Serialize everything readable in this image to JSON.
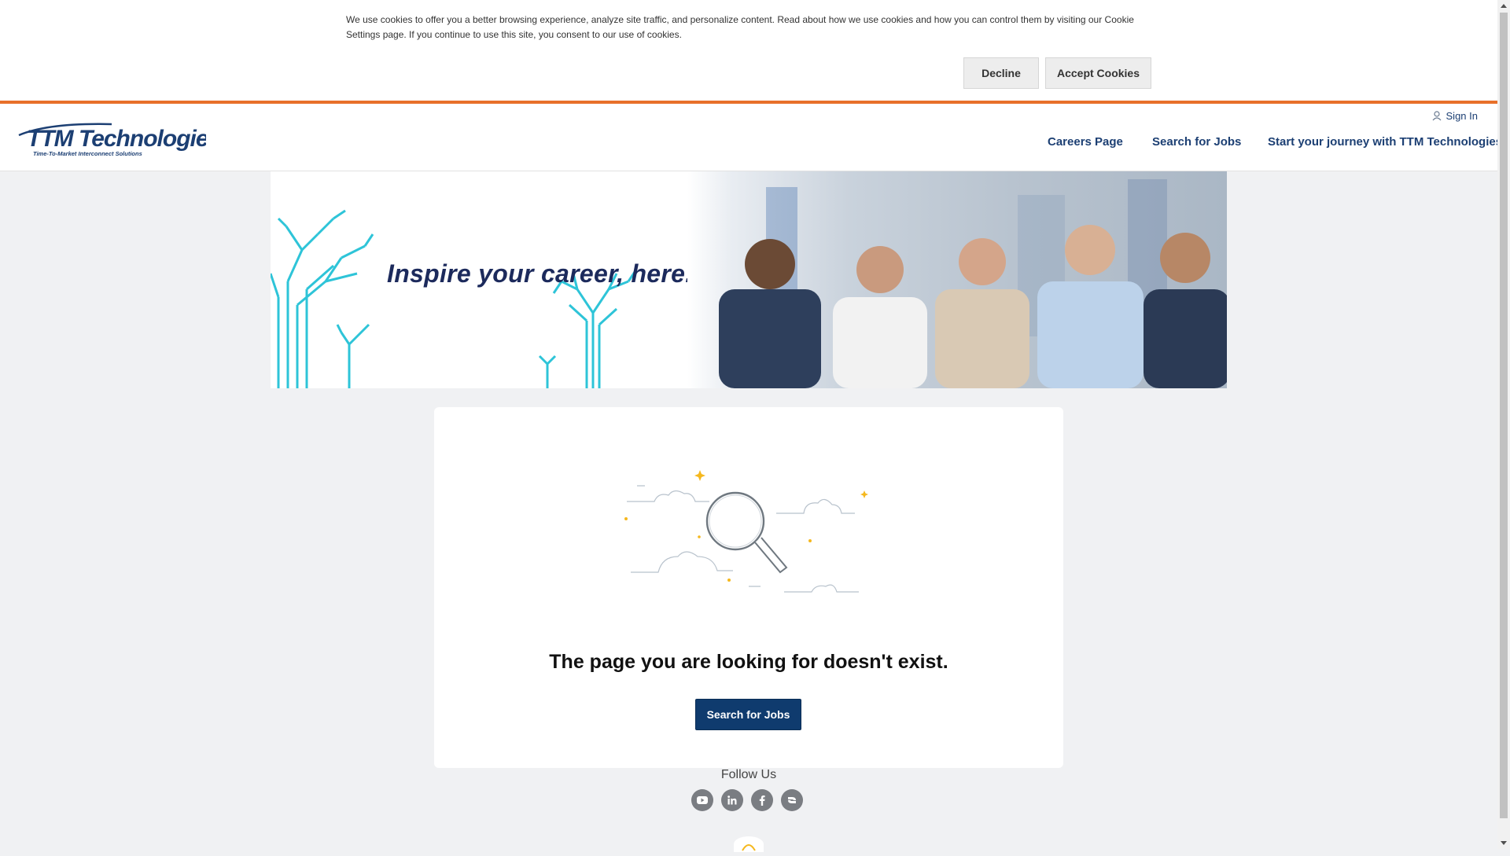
{
  "cookie_banner": {
    "text": "We use cookies to offer you a better browsing experience, analyze site traffic, and personalize content. Read about how we use cookies and how you can control them by visiting our Cookie Settings page. If you continue to use this site, you consent to our use of cookies.",
    "decline_label": "Decline",
    "accept_label": "Accept Cookies"
  },
  "header": {
    "logo_text": "TTM Technologies",
    "logo_tagline": "Time-To-Market Interconnect Solutions",
    "sign_in_label": "Sign In",
    "nav": [
      {
        "label": "Careers Page"
      },
      {
        "label": "Search for Jobs"
      },
      {
        "label": "Start your journey with TTM Technologies!"
      }
    ]
  },
  "banner": {
    "tagline": "Inspire your career, here."
  },
  "error_card": {
    "message": "The page you are looking for doesn't exist.",
    "button_label": "Search for Jobs"
  },
  "footer": {
    "follow_label": "Follow Us",
    "socials": [
      {
        "icon": "youtube-icon"
      },
      {
        "icon": "linkedin-icon"
      },
      {
        "icon": "facebook-icon"
      },
      {
        "icon": "glassdoor-icon"
      }
    ]
  },
  "colors": {
    "accent_orange": "#e8702a",
    "brand_navy": "#0f3b6e",
    "teal": "#2ec4d8"
  }
}
